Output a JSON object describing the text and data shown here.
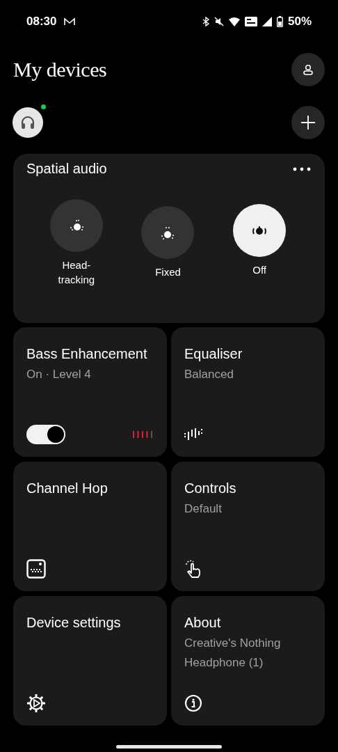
{
  "status_bar": {
    "time": "08:30",
    "battery": "50%"
  },
  "header": {
    "title": "My devices"
  },
  "device": {
    "connected": true
  },
  "spatial_audio": {
    "title": "Spatial audio",
    "modes": [
      {
        "label": "Head-\ntracking",
        "kind": "head",
        "selected": false
      },
      {
        "label": "Fixed",
        "kind": "fixed",
        "selected": false
      },
      {
        "label": "Off",
        "kind": "off",
        "selected": true
      }
    ]
  },
  "tiles": [
    {
      "kind": "toggle",
      "title": "Bass Enhancement",
      "subtitle": "On · Level 4",
      "on": true,
      "level": 0.8
    },
    {
      "kind": "equaliser",
      "title": "Equaliser",
      "subtitle": "Balanced"
    },
    {
      "kind": "channel",
      "title": "Channel Hop"
    },
    {
      "kind": "controls",
      "title": "Controls",
      "subtitle": "Default"
    },
    {
      "kind": "settings",
      "title": "Device settings"
    },
    {
      "kind": "about",
      "title": "About",
      "subtitle": "Creative's Nothing Headphone (1)"
    }
  ]
}
